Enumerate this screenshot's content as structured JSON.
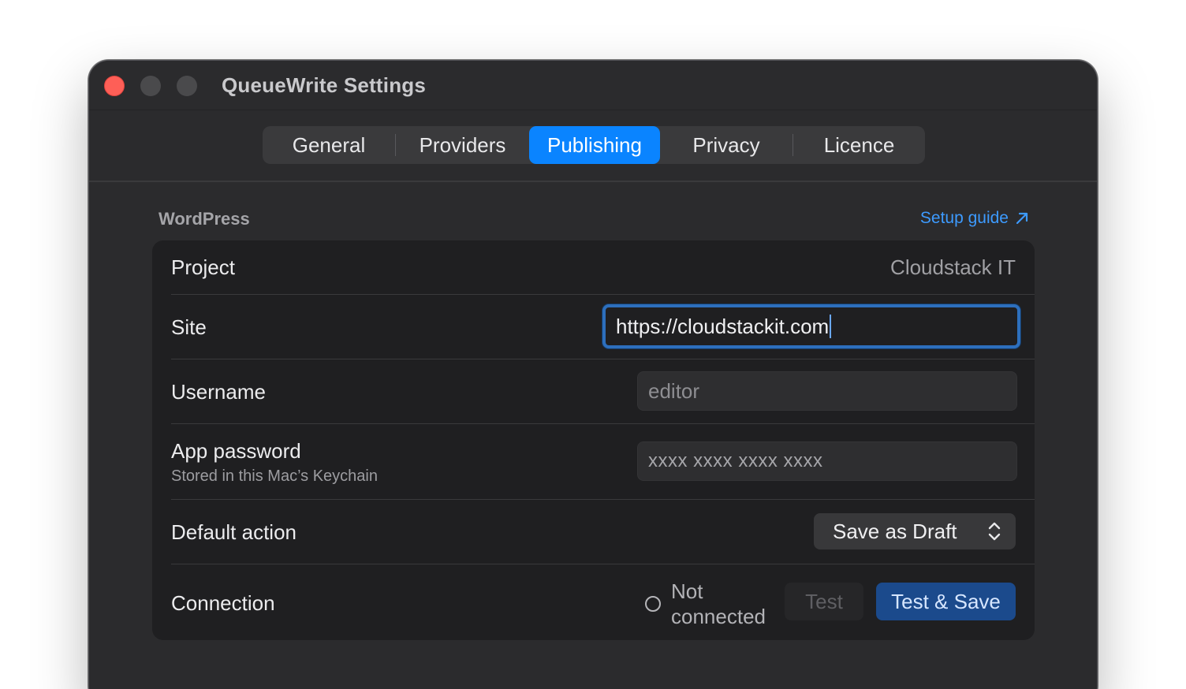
{
  "window": {
    "title": "QueueWrite Settings"
  },
  "tabs": [
    {
      "label": "General",
      "active": false
    },
    {
      "label": "Providers",
      "active": false
    },
    {
      "label": "Publishing",
      "active": true
    },
    {
      "label": "Privacy",
      "active": false
    },
    {
      "label": "Licence",
      "active": false
    }
  ],
  "section": {
    "title": "WordPress",
    "setup_guide_label": "Setup guide",
    "setup_guide_icon": "arrow-up-right-icon"
  },
  "rows": {
    "project": {
      "label": "Project",
      "value": "Cloudstack IT"
    },
    "site": {
      "label": "Site",
      "value": "https://cloudstackit.com"
    },
    "username": {
      "label": "Username",
      "value": "editor"
    },
    "app_password": {
      "label": "App password",
      "sublabel": "Stored in this Mac’s Keychain",
      "value": "xxxx xxxx xxxx xxxx"
    },
    "default_action": {
      "label": "Default action",
      "selected": "Save as Draft"
    },
    "connection": {
      "label": "Connection",
      "status": "Not connected",
      "test_label": "Test",
      "test_save_label": "Test & Save"
    }
  },
  "colors": {
    "accent": "#0a84ff",
    "link": "#3d9bff",
    "close_button": "#fe5f57",
    "primary_button": "#1b4a8c"
  }
}
